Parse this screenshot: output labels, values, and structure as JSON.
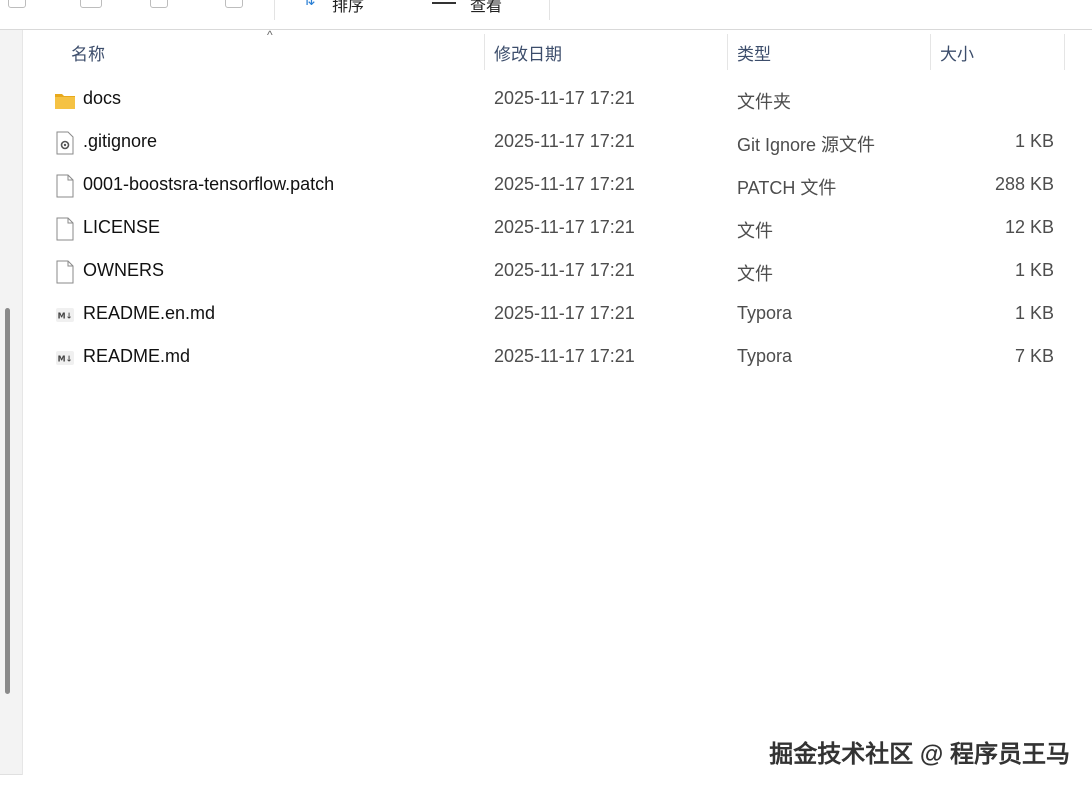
{
  "toolbar": {
    "sort_label": "排序",
    "view_label": "查看"
  },
  "columns": {
    "name": "名称",
    "date": "修改日期",
    "type": "类型",
    "size": "大小"
  },
  "files": [
    {
      "name": "docs",
      "date": "2025-11-17 17:21",
      "type": "文件夹",
      "size": "",
      "icon": "folder-icon"
    },
    {
      "name": ".gitignore",
      "date": "2025-11-17 17:21",
      "type": "Git Ignore 源文件",
      "size": "1 KB",
      "icon": "settings-file-icon"
    },
    {
      "name": "0001-boostsra-tensorflow.patch",
      "date": "2025-11-17 17:21",
      "type": "PATCH 文件",
      "size": "288 KB",
      "icon": "file-icon"
    },
    {
      "name": "LICENSE",
      "date": "2025-11-17 17:21",
      "type": "文件",
      "size": "12 KB",
      "icon": "file-icon"
    },
    {
      "name": "OWNERS",
      "date": "2025-11-17 17:21",
      "type": "文件",
      "size": "1 KB",
      "icon": "file-icon"
    },
    {
      "name": "README.en.md",
      "date": "2025-11-17 17:21",
      "type": "Typora",
      "size": "1 KB",
      "icon": "markdown-file-icon"
    },
    {
      "name": "README.md",
      "date": "2025-11-17 17:21",
      "type": "Typora",
      "size": "7 KB",
      "icon": "markdown-file-icon"
    }
  ],
  "watermark": "掘金技术社区 @ 程序员王马",
  "colors": {
    "folder": "#f5c243",
    "header_text": "#3c4d6b",
    "accent": "#2a7fd4"
  }
}
